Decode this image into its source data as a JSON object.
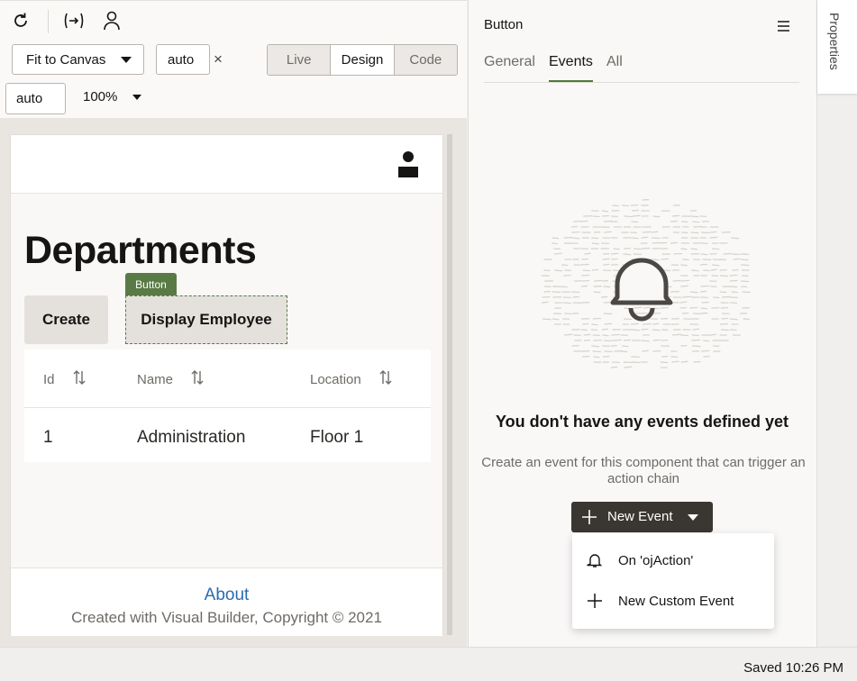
{
  "toolbar": {
    "fit_select": "Fit to Canvas",
    "width_value": "auto",
    "times": "×",
    "height_value": "auto",
    "zoom": "100%",
    "modes": [
      "Live",
      "Design",
      "Code"
    ],
    "active_mode": "Design"
  },
  "canvas_page": {
    "title": "Departments",
    "buttons": {
      "create": "Create",
      "display": "Display Employee"
    },
    "selection_badge": "Button",
    "table": {
      "columns": [
        "Id",
        "Name",
        "Location"
      ],
      "rows": [
        [
          "1",
          "Administration",
          "Floor 1"
        ]
      ]
    },
    "footer": {
      "about": "About",
      "copyright": "Created with Visual Builder, Copyright © 2021"
    }
  },
  "properties": {
    "title": "Button",
    "tabs": [
      "General",
      "Events",
      "All"
    ],
    "active_tab": "Events",
    "empty_title": "You don't have any events defined yet",
    "empty_desc": "Create an event for this component that can trigger an action chain",
    "new_event": "New Event",
    "menu_items": [
      "On 'ojAction'",
      "New Custom Event"
    ]
  },
  "rail": {
    "label": "Properties"
  },
  "status": {
    "saved": "Saved 10:26 PM"
  },
  "colors": {
    "accent_green": "#5a7a45",
    "link_blue": "#2b6bb0",
    "dark_button": "#3a3631"
  }
}
